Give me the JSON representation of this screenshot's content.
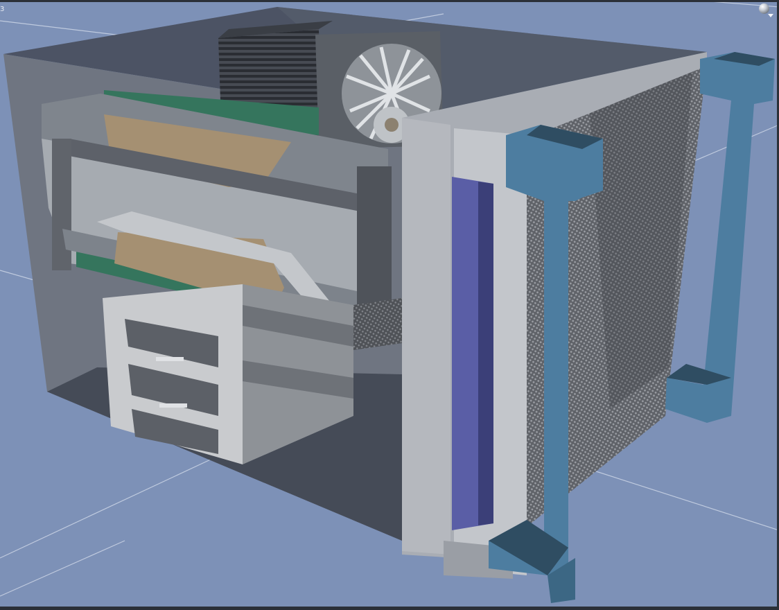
{
  "viewport": {
    "label": "3",
    "background_color": "#7d91b7",
    "grid_color": "#c7d0e2",
    "shading_menu_icon": "shaded-sphere-icon"
  },
  "colors": {
    "case_top": "#4b5262",
    "case_left_panel": "#707783",
    "case_floor": "#4a505d",
    "front_frame": "#a9adb4",
    "blue_strip": "#5a5ea6",
    "handle_blue": "#4d7da0",
    "handle_dark": "#2f4d62",
    "mesh": "#6b6e74",
    "gpu_shroud": "#8d939b",
    "gpu_pad": "#a59072",
    "pcb_green": "#35755d",
    "drive_cage": "#c9cbce",
    "fan": "#c7cacd"
  }
}
